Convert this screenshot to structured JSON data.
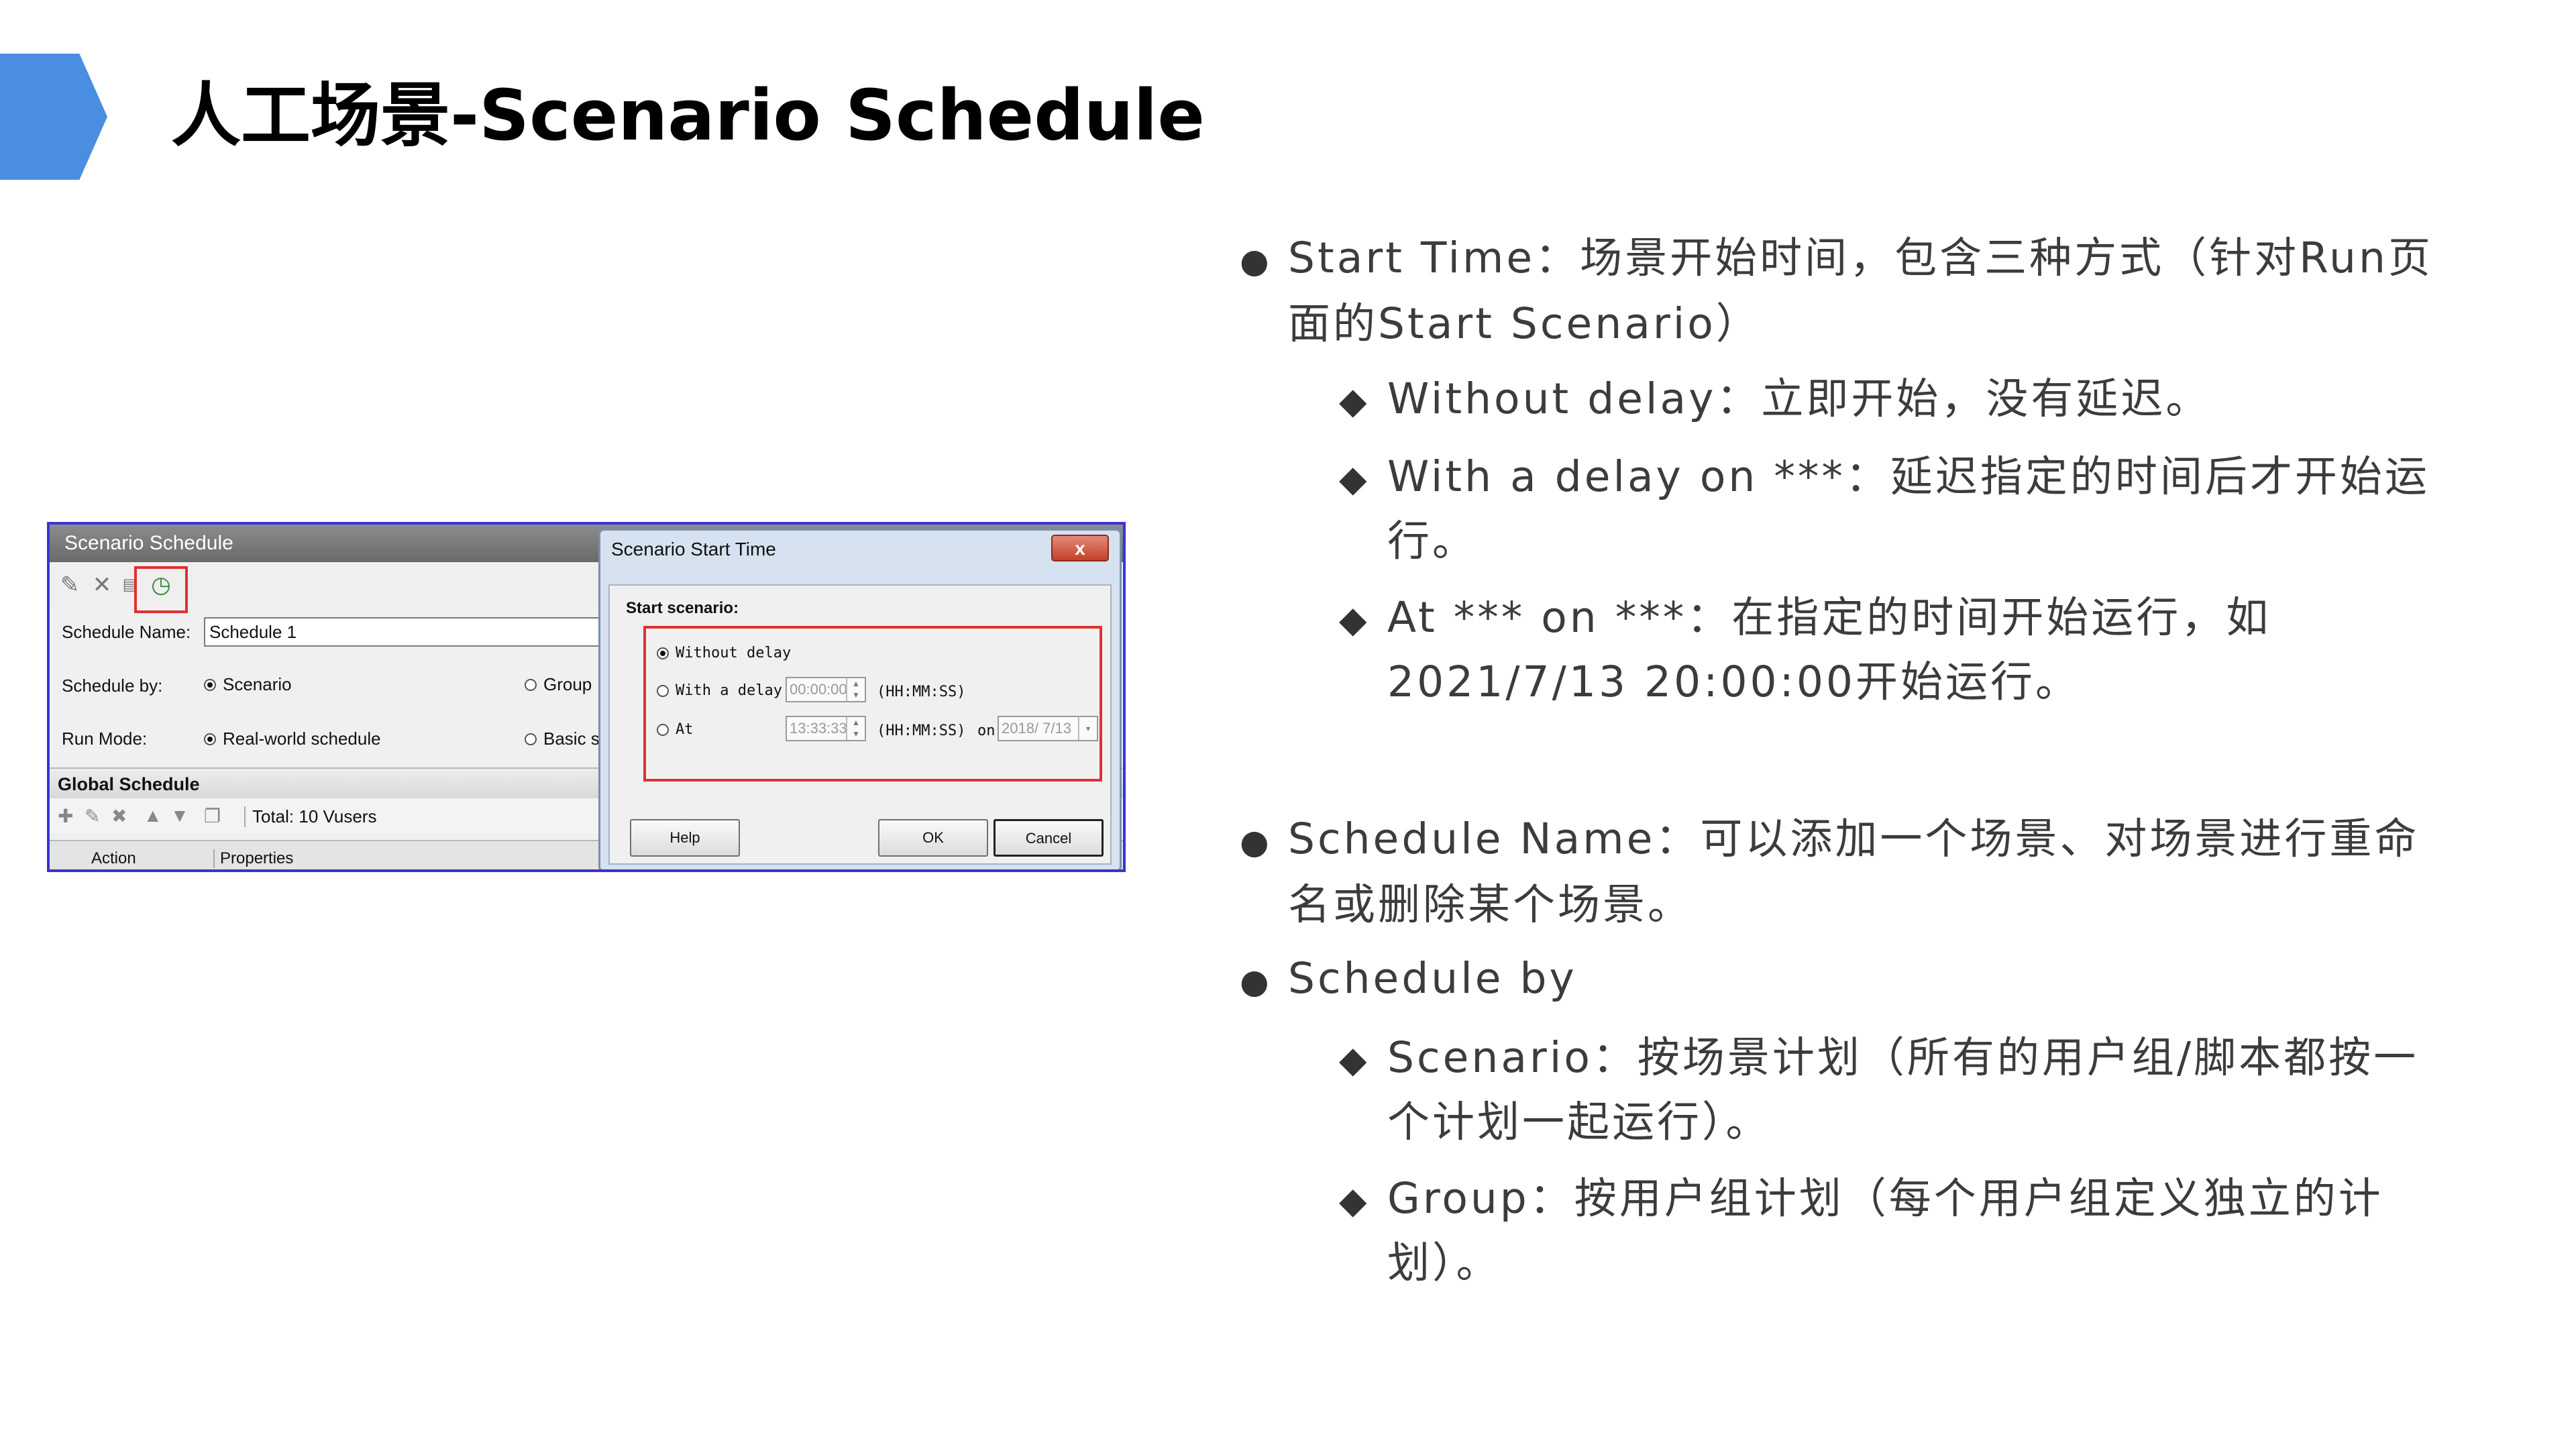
{
  "slide": {
    "title": "人工场景-Scenario Schedule",
    "accent_color": "#4a8ee2"
  },
  "screenshot": {
    "schedule_window": {
      "title": "Scenario Schedule",
      "toolbar_icons": [
        "new-schedule-icon",
        "delete-icon",
        "rename-icon",
        "start-time-clock-icon"
      ],
      "schedule_name_label": "Schedule Name:",
      "schedule_name_value": "Schedule 1",
      "schedule_by_label": "Schedule by:",
      "schedule_by_options": [
        "Scenario",
        "Group"
      ],
      "run_mode_label": "Run Mode:",
      "run_mode_options": [
        "Real-world schedule",
        "Basic sc"
      ],
      "global_schedule_label": "Global Schedule",
      "total_vusers": "Total: 10 Vusers",
      "grid_columns": [
        "Action",
        "Properties"
      ]
    },
    "start_time_dialog": {
      "title": "Scenario Start Time",
      "close_glyph": "x",
      "section_label": "Start scenario:",
      "option_without_delay": "Without delay",
      "option_with_delay": "With a delay o",
      "delay_value": "00:00:00",
      "option_at": "At",
      "at_time_value": "13:33:33",
      "time_format_1": "(HH:MM:SS)",
      "time_format_2": "(HH:MM:SS)",
      "on_label": "on",
      "date_value": "2018/ 7/13",
      "help_button": "Help",
      "ok_button": "OK",
      "cancel_button": "Cancel"
    },
    "highlight_color": "#e03030"
  },
  "bullets": {
    "dot_symbol": "●",
    "diamond_symbol": "◆",
    "start_time": "Start Time：场景开始时间，包含三种方式（针对Run页面的Start Scenario）",
    "without_delay": "Without delay：立即开始，没有延迟。",
    "with_delay": "With a delay on ***：延迟指定的时间后才开始运行。",
    "at_on": "At *** on ***：在指定的时间开始运行，如2021/7/13 20:00:00开始运行。",
    "schedule_name": "Schedule Name：可以添加一个场景、对场景进行重命名或删除某个场景。",
    "schedule_by": "Schedule by",
    "scenario": "Scenario：按场景计划（所有的用户组/脚本都按一个计划一起运行）。",
    "group": "Group：按用户组计划（每个用户组定义独立的计划）。"
  }
}
